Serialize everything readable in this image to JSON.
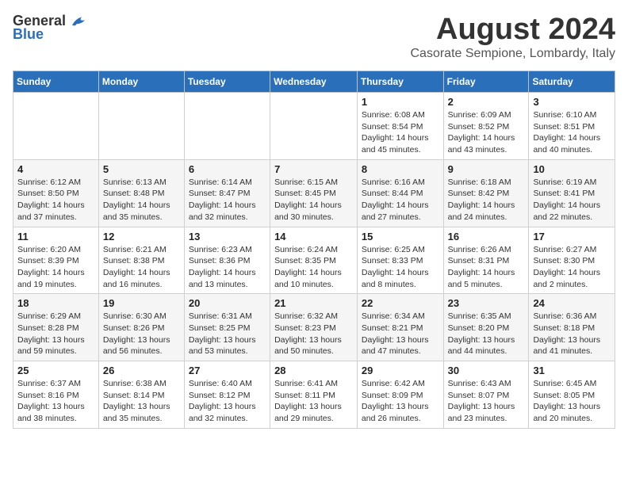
{
  "logo": {
    "general": "General",
    "blue": "Blue"
  },
  "title": {
    "month_year": "August 2024",
    "location": "Casorate Sempione, Lombardy, Italy"
  },
  "days_of_week": [
    "Sunday",
    "Monday",
    "Tuesday",
    "Wednesday",
    "Thursday",
    "Friday",
    "Saturday"
  ],
  "weeks": [
    [
      {
        "day": "",
        "info": ""
      },
      {
        "day": "",
        "info": ""
      },
      {
        "day": "",
        "info": ""
      },
      {
        "day": "",
        "info": ""
      },
      {
        "day": "1",
        "info": "Sunrise: 6:08 AM\nSunset: 8:54 PM\nDaylight: 14 hours and 45 minutes."
      },
      {
        "day": "2",
        "info": "Sunrise: 6:09 AM\nSunset: 8:52 PM\nDaylight: 14 hours and 43 minutes."
      },
      {
        "day": "3",
        "info": "Sunrise: 6:10 AM\nSunset: 8:51 PM\nDaylight: 14 hours and 40 minutes."
      }
    ],
    [
      {
        "day": "4",
        "info": "Sunrise: 6:12 AM\nSunset: 8:50 PM\nDaylight: 14 hours and 37 minutes."
      },
      {
        "day": "5",
        "info": "Sunrise: 6:13 AM\nSunset: 8:48 PM\nDaylight: 14 hours and 35 minutes."
      },
      {
        "day": "6",
        "info": "Sunrise: 6:14 AM\nSunset: 8:47 PM\nDaylight: 14 hours and 32 minutes."
      },
      {
        "day": "7",
        "info": "Sunrise: 6:15 AM\nSunset: 8:45 PM\nDaylight: 14 hours and 30 minutes."
      },
      {
        "day": "8",
        "info": "Sunrise: 6:16 AM\nSunset: 8:44 PM\nDaylight: 14 hours and 27 minutes."
      },
      {
        "day": "9",
        "info": "Sunrise: 6:18 AM\nSunset: 8:42 PM\nDaylight: 14 hours and 24 minutes."
      },
      {
        "day": "10",
        "info": "Sunrise: 6:19 AM\nSunset: 8:41 PM\nDaylight: 14 hours and 22 minutes."
      }
    ],
    [
      {
        "day": "11",
        "info": "Sunrise: 6:20 AM\nSunset: 8:39 PM\nDaylight: 14 hours and 19 minutes."
      },
      {
        "day": "12",
        "info": "Sunrise: 6:21 AM\nSunset: 8:38 PM\nDaylight: 14 hours and 16 minutes."
      },
      {
        "day": "13",
        "info": "Sunrise: 6:23 AM\nSunset: 8:36 PM\nDaylight: 14 hours and 13 minutes."
      },
      {
        "day": "14",
        "info": "Sunrise: 6:24 AM\nSunset: 8:35 PM\nDaylight: 14 hours and 10 minutes."
      },
      {
        "day": "15",
        "info": "Sunrise: 6:25 AM\nSunset: 8:33 PM\nDaylight: 14 hours and 8 minutes."
      },
      {
        "day": "16",
        "info": "Sunrise: 6:26 AM\nSunset: 8:31 PM\nDaylight: 14 hours and 5 minutes."
      },
      {
        "day": "17",
        "info": "Sunrise: 6:27 AM\nSunset: 8:30 PM\nDaylight: 14 hours and 2 minutes."
      }
    ],
    [
      {
        "day": "18",
        "info": "Sunrise: 6:29 AM\nSunset: 8:28 PM\nDaylight: 13 hours and 59 minutes."
      },
      {
        "day": "19",
        "info": "Sunrise: 6:30 AM\nSunset: 8:26 PM\nDaylight: 13 hours and 56 minutes."
      },
      {
        "day": "20",
        "info": "Sunrise: 6:31 AM\nSunset: 8:25 PM\nDaylight: 13 hours and 53 minutes."
      },
      {
        "day": "21",
        "info": "Sunrise: 6:32 AM\nSunset: 8:23 PM\nDaylight: 13 hours and 50 minutes."
      },
      {
        "day": "22",
        "info": "Sunrise: 6:34 AM\nSunset: 8:21 PM\nDaylight: 13 hours and 47 minutes."
      },
      {
        "day": "23",
        "info": "Sunrise: 6:35 AM\nSunset: 8:20 PM\nDaylight: 13 hours and 44 minutes."
      },
      {
        "day": "24",
        "info": "Sunrise: 6:36 AM\nSunset: 8:18 PM\nDaylight: 13 hours and 41 minutes."
      }
    ],
    [
      {
        "day": "25",
        "info": "Sunrise: 6:37 AM\nSunset: 8:16 PM\nDaylight: 13 hours and 38 minutes."
      },
      {
        "day": "26",
        "info": "Sunrise: 6:38 AM\nSunset: 8:14 PM\nDaylight: 13 hours and 35 minutes."
      },
      {
        "day": "27",
        "info": "Sunrise: 6:40 AM\nSunset: 8:12 PM\nDaylight: 13 hours and 32 minutes."
      },
      {
        "day": "28",
        "info": "Sunrise: 6:41 AM\nSunset: 8:11 PM\nDaylight: 13 hours and 29 minutes."
      },
      {
        "day": "29",
        "info": "Sunrise: 6:42 AM\nSunset: 8:09 PM\nDaylight: 13 hours and 26 minutes."
      },
      {
        "day": "30",
        "info": "Sunrise: 6:43 AM\nSunset: 8:07 PM\nDaylight: 13 hours and 23 minutes."
      },
      {
        "day": "31",
        "info": "Sunrise: 6:45 AM\nSunset: 8:05 PM\nDaylight: 13 hours and 20 minutes."
      }
    ]
  ]
}
